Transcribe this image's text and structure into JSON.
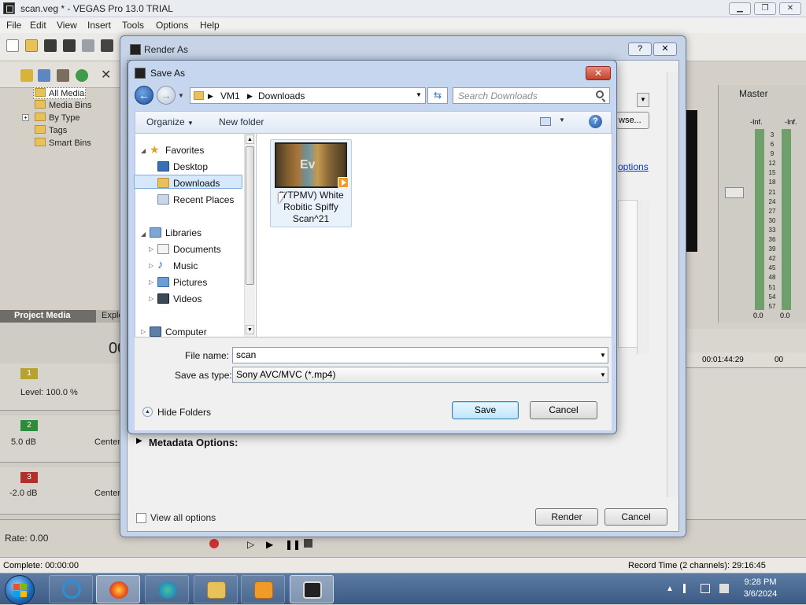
{
  "vegas": {
    "title": "scan.veg * - VEGAS Pro 13.0 TRIAL",
    "window_buttons": [
      "minimize",
      "restore",
      "close"
    ],
    "menu": [
      "File",
      "Edit",
      "View",
      "Insert",
      "Tools",
      "Options",
      "Help"
    ],
    "media_tree": [
      "All Media",
      "Media Bins",
      "By Type",
      "Tags",
      "Smart Bins"
    ],
    "tabs": {
      "project_media": "Project Media",
      "explorer": "Explo"
    },
    "time_display": "00",
    "tracks": [
      {
        "number": "1",
        "level": "Level: 100.0 %",
        "color": "#b5a230"
      },
      {
        "number": "2",
        "volume": "5.0 dB",
        "pan": "Center",
        "color": "#2e8b3c"
      },
      {
        "number": "3",
        "volume": "-2.0 dB",
        "pan": "Center",
        "color": "#b0302e"
      }
    ],
    "master": {
      "label": "Master",
      "inf_left": "-Inf.",
      "inf_right": "-Inf.",
      "scale": [
        "3",
        "6",
        "9",
        "12",
        "15",
        "18",
        "21",
        "24",
        "27",
        "30",
        "33",
        "36",
        "39",
        "42",
        "45",
        "48",
        "51",
        "54",
        "57"
      ],
      "zero_left": "0.0",
      "zero_right": "0.0"
    },
    "ruler_time": "00:01:44:29",
    "ruler_time_2": "00",
    "rate": "Rate: 0.00",
    "status_left": "Complete: 00:00:00",
    "status_right": "Record Time (2 channels): 29:16:45"
  },
  "render_dialog": {
    "title": "Render As",
    "browse_label": "wse...",
    "options_link": "options",
    "metadata_label": "Metadata Options:",
    "view_all_label": "View all options",
    "render_button": "Render",
    "cancel_button": "Cancel"
  },
  "save_dialog": {
    "title": "Save As",
    "breadcrumb": [
      "VM1",
      "Downloads"
    ],
    "search_placeholder": "Search Downloads",
    "organize_label": "Organize",
    "new_folder_label": "New folder",
    "nav": {
      "favorites": "Favorites",
      "desktop": "Desktop",
      "downloads": "Downloads",
      "recent": "Recent Places",
      "libraries": "Libraries",
      "documents": "Documents",
      "music": "Music",
      "pictures": "Pictures",
      "videos": "Videos",
      "computer": "Computer"
    },
    "file_item": {
      "name": "(YTPMV) White Robitic Spiffy Scan^21",
      "thumb_text": "Ev"
    },
    "file_name_label": "File name:",
    "file_name_value": "scan",
    "save_type_label": "Save as type:",
    "save_type_value": "Sony AVC/MVC (*.mp4)",
    "hide_folders_label": "Hide Folders",
    "save_button": "Save",
    "cancel_button": "Cancel"
  },
  "taskbar": {
    "apps": [
      "internet-explorer",
      "firefox",
      "edge",
      "file-explorer",
      "media-player",
      "vegas"
    ],
    "time": "9:28 PM",
    "date": "3/6/2024"
  }
}
